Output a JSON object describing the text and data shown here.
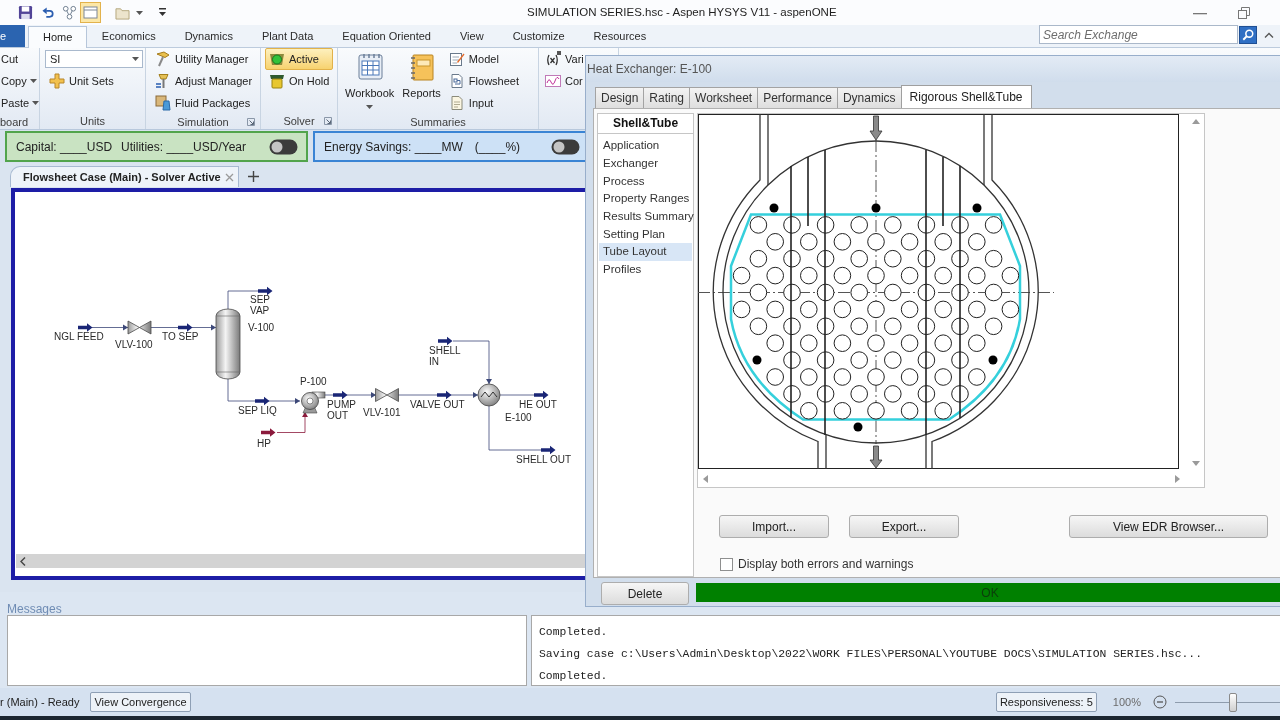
{
  "window": {
    "title": "SIMULATION SERIES.hsc - Aspen HYSYS V11 - aspenONE"
  },
  "ribbon": {
    "tabs": [
      {
        "label": "e",
        "kind": "file",
        "selected": false
      },
      {
        "label": "Home",
        "kind": "tab",
        "selected": true
      },
      {
        "label": "Economics",
        "kind": "tab",
        "selected": false
      },
      {
        "label": "Dynamics",
        "kind": "tab",
        "selected": false
      },
      {
        "label": "Plant Data",
        "kind": "tab",
        "selected": false
      },
      {
        "label": "Equation Oriented",
        "kind": "tab",
        "selected": false
      },
      {
        "label": "View",
        "kind": "tab",
        "selected": false
      },
      {
        "label": "Customize",
        "kind": "tab",
        "selected": false
      },
      {
        "label": "Resources",
        "kind": "tab",
        "selected": false
      }
    ],
    "search": {
      "placeholder": "Search Exchange"
    },
    "groups": [
      {
        "label": "board",
        "launcher": false,
        "items": [
          {
            "kind": "small",
            "label": "Cut",
            "dropdown": false
          },
          {
            "kind": "small",
            "label": "Copy",
            "dropdown": true
          },
          {
            "kind": "small",
            "label": "Paste",
            "dropdown": true
          }
        ]
      },
      {
        "label": "Units",
        "launcher": false,
        "items": [
          {
            "kind": "select",
            "value": "SI"
          },
          {
            "kind": "small",
            "label": "Unit Sets",
            "dropdown": false
          }
        ]
      },
      {
        "label": "Simulation",
        "launcher": true,
        "items": [
          {
            "kind": "small",
            "label": "Utility Manager",
            "dropdown": false
          },
          {
            "kind": "small",
            "label": "Adjust Manager",
            "dropdown": false
          },
          {
            "kind": "small",
            "label": "Fluid Packages",
            "dropdown": false
          }
        ]
      },
      {
        "label": "Solver",
        "launcher": true,
        "items": [
          {
            "kind": "small",
            "label": "Active",
            "dropdown": false,
            "selected": true
          },
          {
            "kind": "small",
            "label": "On Hold",
            "dropdown": false,
            "selected": false
          }
        ]
      },
      {
        "label": "Summaries",
        "launcher": false,
        "items": [
          {
            "kind": "large",
            "label": "Workbook",
            "dropdown": true
          },
          {
            "kind": "large",
            "label": "Reports",
            "dropdown": false
          },
          {
            "kind": "small",
            "label": "Model",
            "dropdown": false
          },
          {
            "kind": "small",
            "label": "Flowsheet",
            "dropdown": false
          },
          {
            "kind": "small",
            "label": "Input",
            "dropdown": false
          }
        ]
      },
      {
        "items": [
          {
            "kind": "small",
            "label": "Vari",
            "dropdown": false
          },
          {
            "kind": "small",
            "label": "Cor",
            "dropdown": false
          }
        ]
      }
    ]
  },
  "banners": [
    {
      "kind": "cost",
      "texts": [
        "Capital: ____USD",
        "Utilities: ____USD/Year"
      ],
      "on": false
    },
    {
      "kind": "energy",
      "texts": [
        "Energy Savings: ____MW",
        "(____%)"
      ],
      "on": false
    }
  ],
  "flowsheet": {
    "tabs": [
      {
        "label": "Flowsheet Case (Main) - Solver Active",
        "selected": true
      }
    ],
    "streams": [
      {
        "label": "NGL FEED",
        "kind": "material"
      },
      {
        "label": "TO SEP",
        "kind": "material"
      },
      {
        "label": "SEP VAP",
        "kind": "material"
      },
      {
        "label": "SEP LIQ",
        "kind": "material"
      },
      {
        "label": "HP",
        "kind": "energy"
      },
      {
        "label": "PUMP OUT",
        "kind": "material"
      },
      {
        "label": "VALVE OUT",
        "kind": "material"
      },
      {
        "label": "SHELL IN",
        "kind": "material"
      },
      {
        "label": "HE OUT",
        "kind": "material"
      },
      {
        "label": "SHELL OUT",
        "kind": "material"
      }
    ],
    "units": [
      {
        "label": "VLV-100",
        "kind": "valve"
      },
      {
        "label": "V-100",
        "kind": "separator"
      },
      {
        "label": "P-100",
        "kind": "pump"
      },
      {
        "label": "VLV-101",
        "kind": "valve"
      },
      {
        "label": "E-100",
        "kind": "heat_exchanger"
      }
    ]
  },
  "messages": {
    "title": "Messages",
    "log": [
      "Completed.",
      "Saving case c:\\Users\\Admin\\Desktop\\2022\\WORK FILES\\PERSONAL\\YOUTUBE DOCS\\SIMULATION SERIES.hsc...",
      "Completed."
    ]
  },
  "status_bar": {
    "text": "r (Main) - Ready",
    "buttons": [
      "View Convergence",
      "Responsiveness: 5"
    ],
    "zoom": "100%",
    "zoom_slider": {
      "level": 0.5
    }
  },
  "dialog": {
    "title": "Heat Exchanger: E-100",
    "tabs": [
      {
        "label": "Design",
        "selected": false
      },
      {
        "label": "Rating",
        "selected": false
      },
      {
        "label": "Worksheet",
        "selected": false
      },
      {
        "label": "Performance",
        "selected": false
      },
      {
        "label": "Dynamics",
        "selected": false
      },
      {
        "label": "Rigorous Shell&Tube",
        "selected": true
      }
    ],
    "nav": {
      "header": "Shell&Tube",
      "items": [
        {
          "label": "Application",
          "selected": false
        },
        {
          "label": "Exchanger",
          "selected": false
        },
        {
          "label": "Process",
          "selected": false
        },
        {
          "label": "Property Ranges",
          "selected": false
        },
        {
          "label": "Results Summary",
          "selected": false
        },
        {
          "label": "Setting Plan",
          "selected": false
        },
        {
          "label": "Tube Layout",
          "selected": true
        },
        {
          "label": "Profiles",
          "selected": false
        }
      ]
    },
    "buttons": [
      "Import...",
      "Export...",
      "View EDR Browser..."
    ],
    "checkbox": {
      "label": "Display both errors and warnings",
      "checked": false
    },
    "delete_button": "Delete",
    "status": {
      "label": "OK",
      "kind": "ok"
    }
  }
}
